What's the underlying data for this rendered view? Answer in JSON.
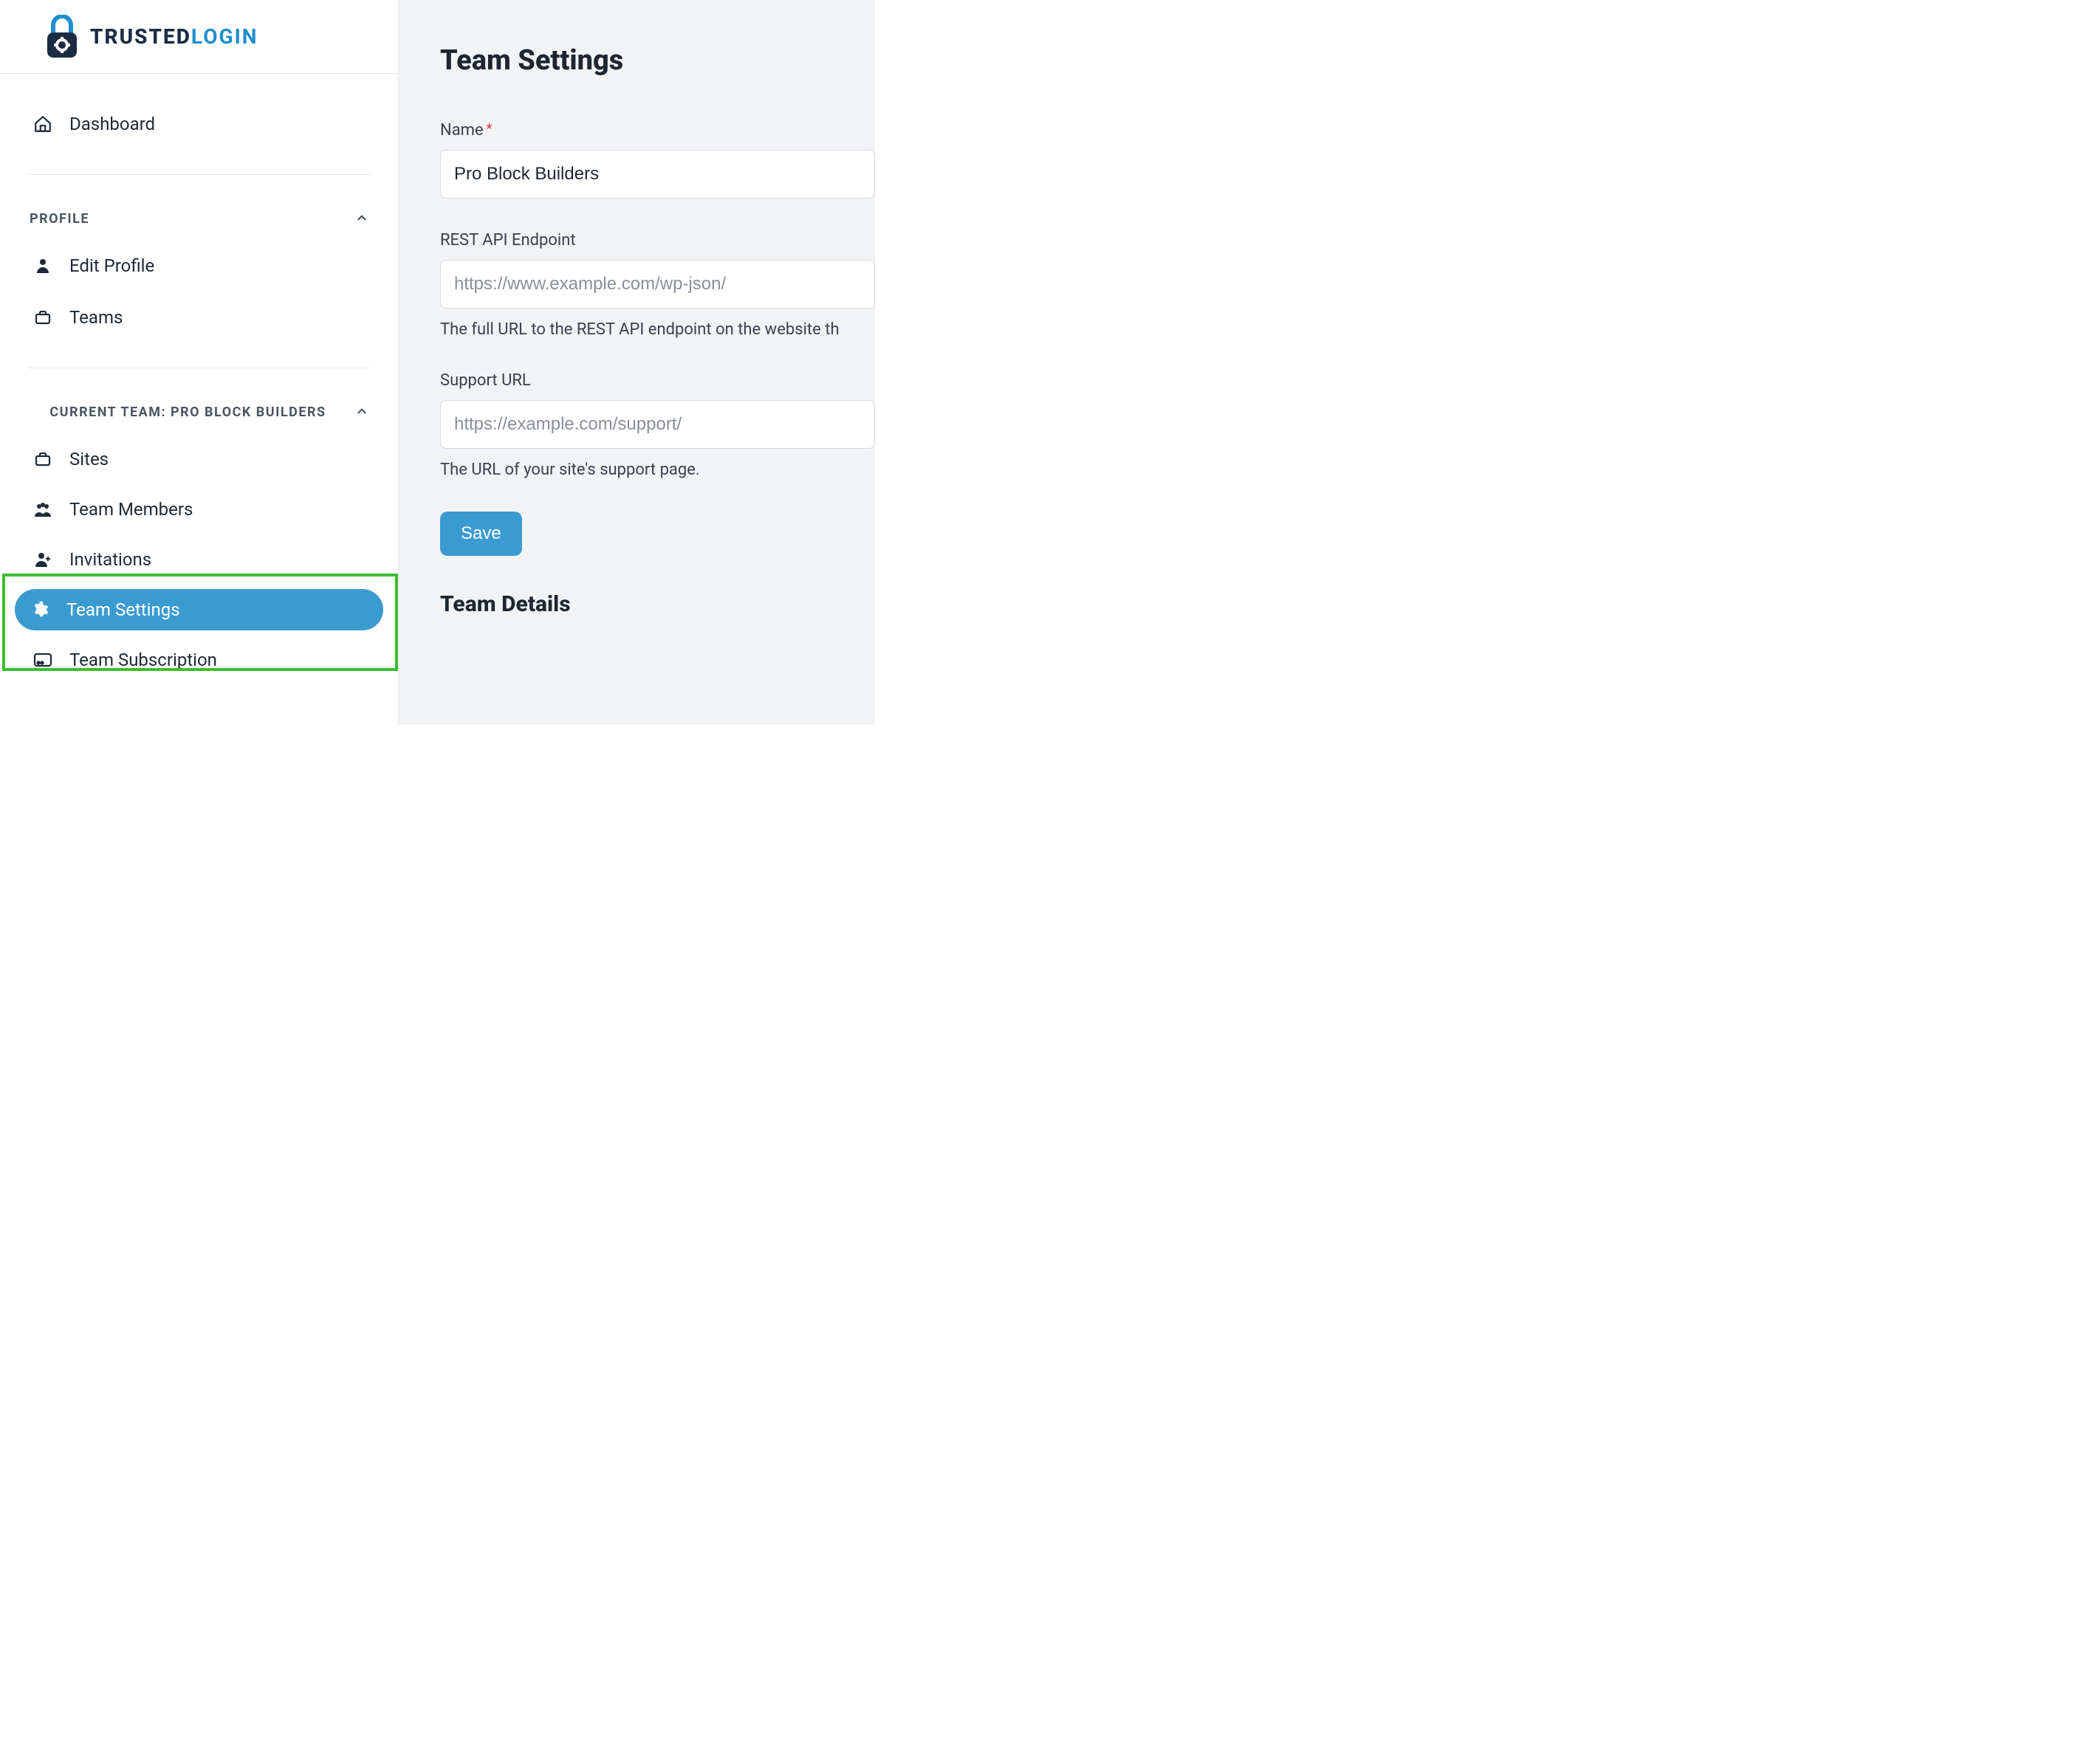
{
  "logo": {
    "part1": "TRUSTED",
    "part2": "LOGIN"
  },
  "sidebar": {
    "dashboard": "Dashboard",
    "profile_section": "PROFILE",
    "edit_profile": "Edit Profile",
    "teams": "Teams",
    "current_team_section": "CURRENT TEAM: PRO BLOCK BUILDERS",
    "sites": "Sites",
    "team_members": "Team Members",
    "invitations": "Invitations",
    "team_settings": "Team Settings",
    "team_subscription": "Team Subscription"
  },
  "main": {
    "title": "Team Settings",
    "name_label": "Name",
    "name_value": "Pro Block Builders",
    "rest_label": "REST API Endpoint",
    "rest_placeholder": "https://www.example.com/wp-json/",
    "rest_help": "The full URL to the REST API endpoint on the website th",
    "support_label": "Support URL",
    "support_placeholder": "https://example.com/support/",
    "support_help": "The URL of your site's support page.",
    "save": "Save",
    "details_title": "Team Details"
  },
  "colors": {
    "accent": "#3a9bd1",
    "highlight": "#3ebd2f",
    "dark": "#1b2b44"
  }
}
